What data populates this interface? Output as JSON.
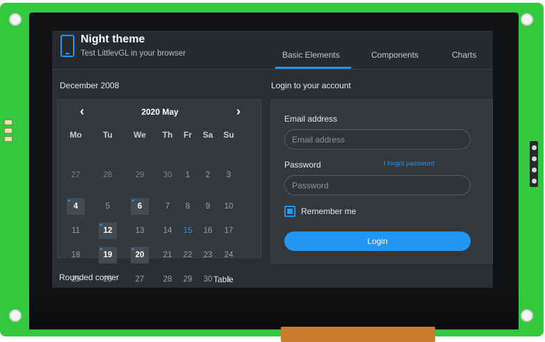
{
  "header": {
    "title": "Night theme",
    "subtitle": "Test LittlevGL in your browser",
    "icon": "phone-icon",
    "tabs": [
      "Basic Elements",
      "Components",
      "Charts"
    ],
    "active_tab": "Basic Elements"
  },
  "calendar": {
    "section_label": "December 2008",
    "month_label": "2020 May",
    "prev_icon": "chevron-left-icon",
    "next_icon": "chevron-right-icon",
    "day_names": [
      "Mo",
      "Tu",
      "We",
      "Th",
      "Fr",
      "Sa",
      "Su"
    ],
    "weeks": [
      [
        "27",
        "28",
        "29",
        "30",
        "1",
        "2",
        "3"
      ],
      [
        "4",
        "5",
        "6",
        "7",
        "8",
        "9",
        "10"
      ],
      [
        "11",
        "12",
        "13",
        "14",
        "15",
        "16",
        "17"
      ],
      [
        "18",
        "19",
        "20",
        "21",
        "22",
        "23",
        "24"
      ],
      [
        "25",
        "26",
        "27",
        "28",
        "29",
        "30",
        "1"
      ]
    ],
    "highlighted_days": [
      "4",
      "6",
      "12",
      "19",
      "20"
    ],
    "today": "15"
  },
  "login": {
    "section_label": "Login to your account",
    "email_label": "Email address",
    "email_placeholder": "Email address",
    "password_label": "Password",
    "password_placeholder": "Password",
    "forgot_link": "I forgot password",
    "remember_label": "Remember me",
    "remember_checked": true,
    "login_button": "Login"
  },
  "bottom": {
    "rounded_corner_label": "Rounded corner",
    "table_label": "Table"
  },
  "colors": {
    "accent": "#2196f3",
    "background": "#2b2f33",
    "card": "#33383d",
    "pcb": "#34c83e"
  }
}
